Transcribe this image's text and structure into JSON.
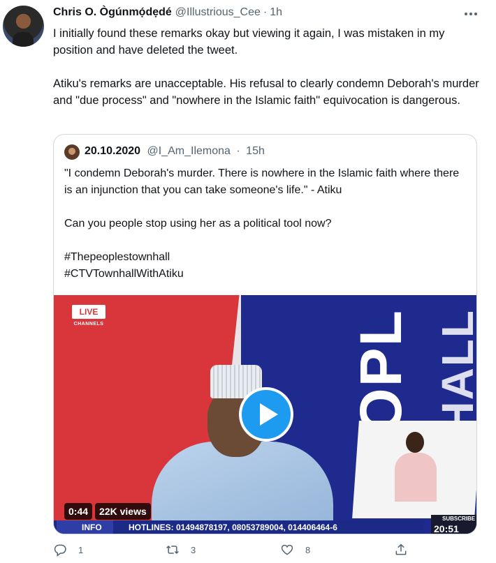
{
  "tweet": {
    "author_name": "Chris O. Ògúnmọ́dẹdé",
    "author_handle": "@Illustrious_Cee",
    "separator": "·",
    "time": "1h",
    "paragraphs": [
      "I initially found these remarks okay but viewing it again, I was mistaken in my position and have deleted the tweet.",
      "Atiku's remarks are unacceptable. His refusal to clearly condemn Deborah's murder and \"due process\" and \"nowhere in the Islamic faith\" equivocation is dangerous."
    ]
  },
  "quoted": {
    "author_name": "20.10.2020",
    "author_handle": "@I_Am_Ilemona",
    "separator": "·",
    "time": "15h",
    "line1": "\"I condemn Deborah's murder. There is nowhere in the Islamic faith where there is an injunction that you can take someone's life.\" - Atiku",
    "line2": "Can you people stop using her as a political tool now?",
    "hashtag1": "#Thepeoplestownhall",
    "hashtag2": "#CTVTownhallWithAtiku",
    "video": {
      "live_label": "LIVE",
      "channels_label": "CHANNELS",
      "duration": "0:44",
      "views": "22K views",
      "ticker_info": "INFO",
      "ticker_hotlines": "HOTLINES: 01494878197, 08053789004, 014406464-6",
      "subscribe": "SUBSCRIBE",
      "clock": "20:51"
    }
  },
  "actions": {
    "reply_count": "1",
    "retweet_count": "3",
    "like_count": "8"
  },
  "icons": [
    "more-icon",
    "play-icon",
    "reply-icon",
    "retweet-icon",
    "like-icon",
    "share-icon"
  ],
  "colors": {
    "accent": "#1d9bf0",
    "secondary_text": "#536471",
    "border": "#cfd9de"
  }
}
